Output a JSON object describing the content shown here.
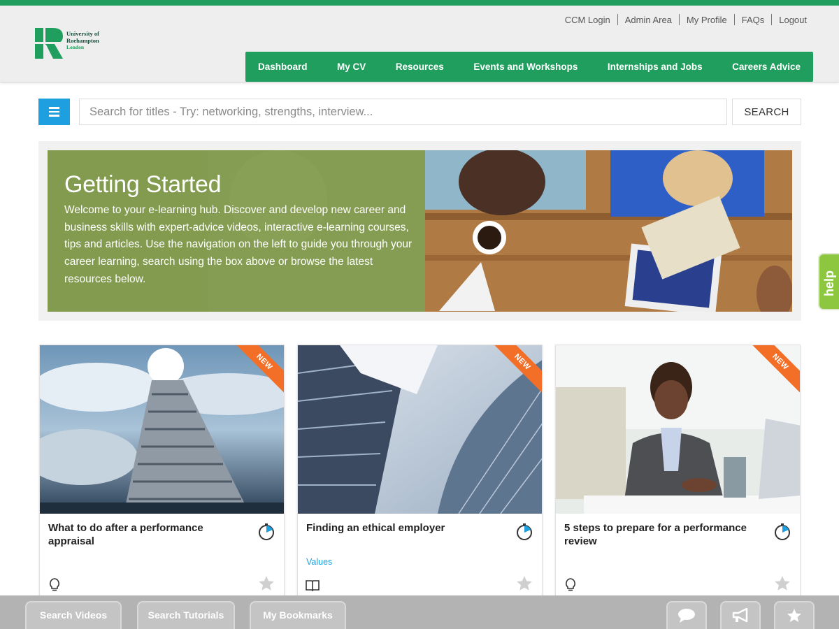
{
  "colors": {
    "brand_green": "#1f9e5d",
    "accent_blue": "#1e9fe0",
    "new_badge": "#f36f27",
    "help_green": "#8dc63f"
  },
  "header": {
    "logo": {
      "line1": "University of",
      "line2": "Roehampton",
      "line3": "London"
    },
    "top_links": [
      "CCM Login",
      "Admin Area",
      "My Profile",
      "FAQs",
      "Logout"
    ],
    "nav": [
      "Dashboard",
      "My CV",
      "Resources",
      "Events and Workshops",
      "Internships and Jobs",
      "Careers Advice"
    ]
  },
  "search": {
    "placeholder": "Search for titles - Try: networking, strengths, interview...",
    "button_label": "SEARCH",
    "menu_icon": "hamburger-icon"
  },
  "banner": {
    "title": "Getting Started",
    "text": "Welcome to your e-learning hub. Discover and develop new career and business skills with expert-advice videos, interactive e-learning courses, tips and articles. Use the navigation on the left to guide you through your career learning, search using the box above or browse the latest resources below."
  },
  "help_tab": {
    "label": "help"
  },
  "cards": [
    {
      "badge": "NEW",
      "title": "What to do after a performance appraisal",
      "tag": "",
      "type_icon": "lightbulb-icon",
      "duration_icon": "stopwatch-icon",
      "bookmark_icon": "star-icon"
    },
    {
      "badge": "NEW",
      "title": "Finding an ethical employer",
      "tag": "Values",
      "type_icon": "book-icon",
      "duration_icon": "stopwatch-icon",
      "bookmark_icon": "star-icon"
    },
    {
      "badge": "NEW",
      "title": "5 steps to prepare for a performance review",
      "tag": "",
      "type_icon": "lightbulb-icon",
      "duration_icon": "stopwatch-icon",
      "bookmark_icon": "star-icon"
    }
  ],
  "bottom_bar": {
    "buttons": [
      "Search Videos",
      "Search Tutorials",
      "My Bookmarks"
    ],
    "icons": [
      "chat-icon",
      "megaphone-icon",
      "star-icon"
    ]
  }
}
